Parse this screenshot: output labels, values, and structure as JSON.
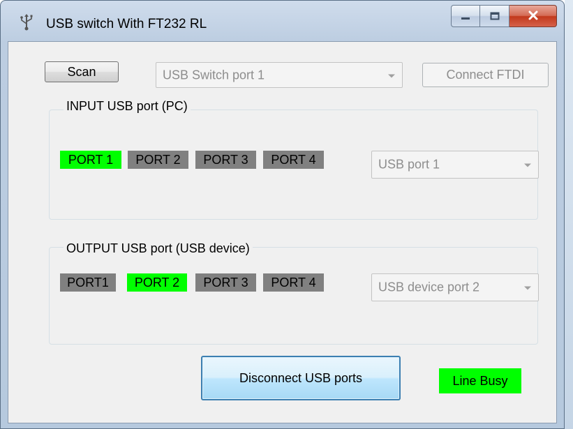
{
  "window": {
    "title": "USB switch With FT232 RL",
    "icon": "usb-icon"
  },
  "toolbar": {
    "scan_label": "Scan",
    "switch_port_value": "USB Switch port 1",
    "connect_label": "Connect FTDI"
  },
  "input_group": {
    "label": "INPUT USB port (PC)",
    "ports": [
      "PORT 1",
      "PORT 2",
      "PORT 3",
      "PORT 4"
    ],
    "active_port": "PORT 1",
    "select_value": "USB port 1"
  },
  "output_group": {
    "label": "OUTPUT USB port (USB device)",
    "ports": [
      "PORT1",
      "PORT 2",
      "PORT 3",
      "PORT 4"
    ],
    "active_port": "PORT 2",
    "select_value": "USB device port 2"
  },
  "actions": {
    "disconnect_label": "Disconnect USB ports"
  },
  "status": {
    "line_text": "Line Busy"
  },
  "colors": {
    "active_port": "#00ff00",
    "inactive_port": "#808080",
    "status_bg": "#00ff00"
  }
}
